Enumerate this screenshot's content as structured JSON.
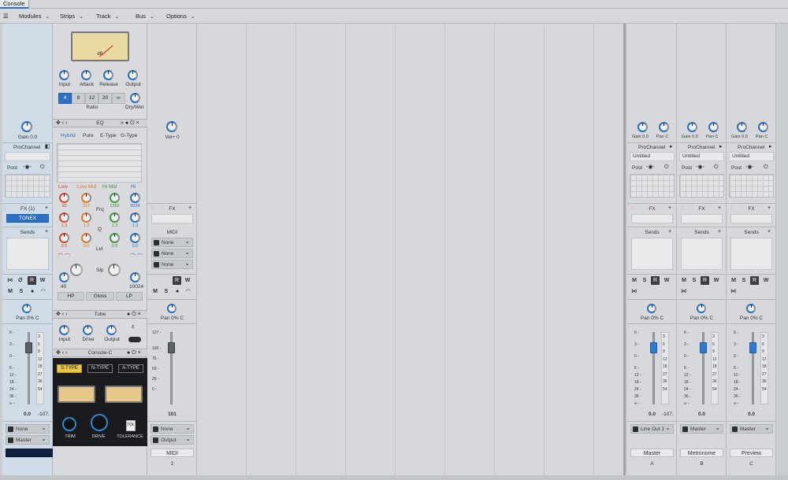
{
  "window": {
    "tab": "Console"
  },
  "menu": {
    "items": [
      "Modules",
      "Strips",
      "Track",
      "Bus",
      "Options"
    ]
  },
  "strip1": {
    "gain": "Gain 0.0",
    "prochannel": "ProChannel",
    "post": "Post",
    "fx": "FX (1)",
    "fx_item": "TONEX",
    "sends": "Sends",
    "pan": "Pan 0% C",
    "vol": "0.0",
    "peak": "-107.",
    "in": "None",
    "out": "Master",
    "name": "Audio",
    "number": "1"
  },
  "pc": {
    "knobs": [
      "Input",
      "Attack",
      "Release",
      "Output"
    ],
    "ratios": [
      "4",
      "8",
      "12",
      "20",
      "∞"
    ],
    "ratio_label": "Ratio",
    "drywet": "Dry/Wet",
    "eq_title": "EQ",
    "eq_modes": [
      "Hybrid",
      "Pure",
      "E-Type",
      "G-Type"
    ],
    "eq_bands": [
      "Low",
      "Low Mid",
      "Hi Mid",
      "Hi"
    ],
    "frq_vals": [
      "90",
      "317",
      "1262",
      "5024"
    ],
    "frq": "Frq",
    "q_vals": [
      "1.3",
      "1.3",
      "1.3",
      "1.3"
    ],
    "q": "Q",
    "lvl_vals": [
      "0.0",
      "0.0",
      "0.0",
      "0.0"
    ],
    "lvl": "Lvl",
    "slp": "Slp",
    "hp_val": "40",
    "lp_val": "10024",
    "hp": "HP",
    "gloss": "Gloss",
    "lp": "LP",
    "tube_title": "Tube",
    "tube_knobs": [
      "Input",
      "Drive",
      "Output"
    ],
    "consolec_title": "Console-C",
    "types": [
      "S-TYPE",
      "N-TYPE",
      "A-TYPE"
    ],
    "cc_knobs": [
      "TRIM",
      "DRIVE",
      "TOLERANCE"
    ],
    "tol": "TOL"
  },
  "strip2": {
    "vel": "Vel+ 0",
    "fx": "FX",
    "midi": "MIDI",
    "midi_ch": [
      "None",
      "None",
      "None"
    ],
    "pan": "Pan 0% C",
    "vol": "101",
    "in": "None",
    "out": "Output",
    "name": "MIDI",
    "number": "2"
  },
  "buses": [
    {
      "gain": "Gain 0.0",
      "pan": "Pan C",
      "prochannel": "ProChannel",
      "preset": "Untitled",
      "post": "Post",
      "fx": "FX",
      "sends": "Sends",
      "pan2": "Pan 0% C",
      "vol": "0.0",
      "peak": "-107.",
      "out": "Line Out 1",
      "name": "Master",
      "letter": "A"
    },
    {
      "gain": "Gain 0.0",
      "pan": "Pan C",
      "prochannel": "ProChannel",
      "preset": "Untitled",
      "post": "Post",
      "fx": "FX",
      "sends": "Sends",
      "pan2": "Pan 0% C",
      "vol": "0.0",
      "peak": "",
      "out": "Master",
      "name": "Metronome",
      "letter": "B"
    },
    {
      "gain": "Gain 0.0",
      "pan": "Pan C",
      "prochannel": "ProChannel",
      "preset": "Untitled",
      "post": "Post",
      "fx": "FX",
      "sends": "Sends",
      "pan2": "Pan 0% C",
      "vol": "0.0",
      "peak": "",
      "out": "Master",
      "name": "Preview",
      "letter": "C"
    }
  ],
  "scale_left": [
    "6 -",
    "3 -",
    "0 -",
    "6 -",
    "12 -",
    "18 -",
    "24 -",
    "36 -",
    "∞ -"
  ],
  "scale_right": [
    "3",
    "6",
    "9",
    "12",
    "18",
    "27",
    "36",
    "54"
  ],
  "vu_scale": "dB",
  "mswr": {
    "m": "M",
    "s": "S",
    "r": "R",
    "w": "W"
  }
}
